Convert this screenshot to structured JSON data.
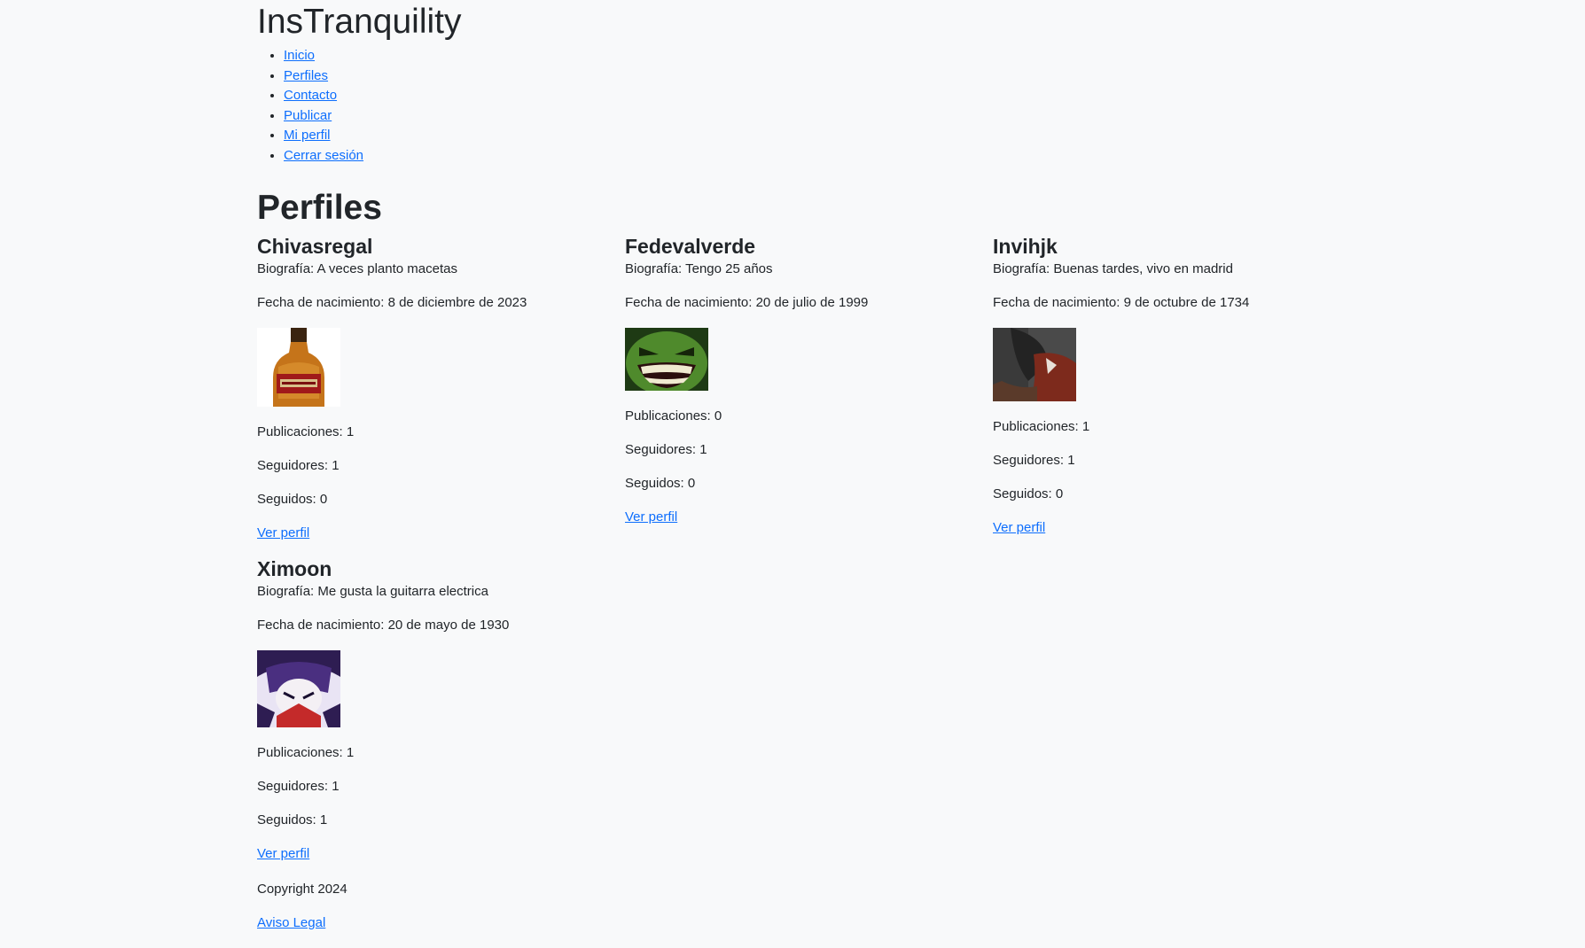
{
  "site": {
    "title": "InsTranquility"
  },
  "nav": {
    "items": [
      {
        "label": "Inicio"
      },
      {
        "label": "Perfiles"
      },
      {
        "label": "Contacto"
      },
      {
        "label": "Publicar"
      },
      {
        "label": "Mi perfil"
      },
      {
        "label": "Cerrar sesión"
      }
    ]
  },
  "page": {
    "title": "Perfiles"
  },
  "profiles": [
    {
      "name": "Chivasregal",
      "bio": "Biografía: A veces planto macetas",
      "birth": "Fecha de nacimiento: 8 de diciembre de 2023",
      "avatar_icon": "whisky-bottle-image",
      "posts": "Publicaciones: 1",
      "followers": "Seguidores: 1",
      "following": "Seguidos: 0",
      "link": "Ver perfil"
    },
    {
      "name": "Fedevalverde",
      "bio": "Biografía: Tengo 25 años",
      "birth": "Fecha de nacimiento: 20 de julio de 1999",
      "avatar_icon": "green-grin-face-image",
      "posts": "Publicaciones: 0",
      "followers": "Seguidores: 1",
      "following": "Seguidos: 0",
      "link": "Ver perfil"
    },
    {
      "name": "Invihjk",
      "bio": "Biografía: Buenas tardes, vivo en madrid",
      "birth": "Fecha de nacimiento: 9 de octubre de 1734",
      "avatar_icon": "helmet-photo-image",
      "posts": "Publicaciones: 1",
      "followers": "Seguidores: 1",
      "following": "Seguidos: 0",
      "link": "Ver perfil"
    },
    {
      "name": "Ximoon",
      "bio": "Biografía: Me gusta la guitarra electrica",
      "birth": "Fecha de nacimiento: 20 de mayo de 1930",
      "avatar_icon": "cartoon-character-image",
      "posts": "Publicaciones: 1",
      "followers": "Seguidores: 1",
      "following": "Seguidos: 1",
      "link": "Ver perfil"
    }
  ],
  "footer": {
    "copyright": "Copyright 2024",
    "legal": "Aviso Legal"
  }
}
